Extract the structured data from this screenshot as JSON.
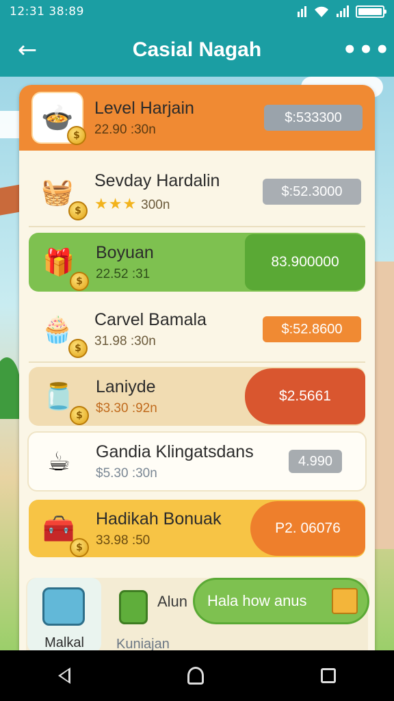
{
  "status_bar": {
    "time": "12:31 38:89"
  },
  "app_bar": {
    "title": "Casial Nagah",
    "back_glyph": "←",
    "more_glyph": "•••"
  },
  "items": [
    {
      "name": "Level Harjain",
      "sub": "22.90 :30n",
      "price": "$:533300",
      "icon": "🍲",
      "style": "orange"
    },
    {
      "name": "Sevday Hardalin",
      "sub": "300n",
      "stars": "★★★",
      "price": "$:52.3000",
      "icon": "🧺",
      "style": "plain-gray"
    },
    {
      "name": "Boyuan",
      "sub": "22.52 :31",
      "price": "83.900000",
      "icon": "🎁",
      "style": "green"
    },
    {
      "name": "Carvel Bamala",
      "sub": "31.98 :30n",
      "price": "$:52.8600",
      "icon": "🧁",
      "style": "plain-orange"
    },
    {
      "name": "Laniyde",
      "sub": "$3.30 :92n",
      "price": "$2.5661",
      "icon": "🫙",
      "style": "tan-red"
    },
    {
      "name": "Gandia Klingatsdans",
      "sub": "$5.30 :30n",
      "price": "4.990",
      "icon": "☕",
      "style": "plain-light"
    },
    {
      "name": "Hadikah Bonuak",
      "sub": "33.98 :50",
      "price": "P2. 06076",
      "icon": "🧰",
      "style": "yellow"
    }
  ],
  "bottom": {
    "tile_label": "Malkal",
    "item_title": "Alun",
    "item_sub": "Kuniajan",
    "cta": "Hala how anus"
  }
}
